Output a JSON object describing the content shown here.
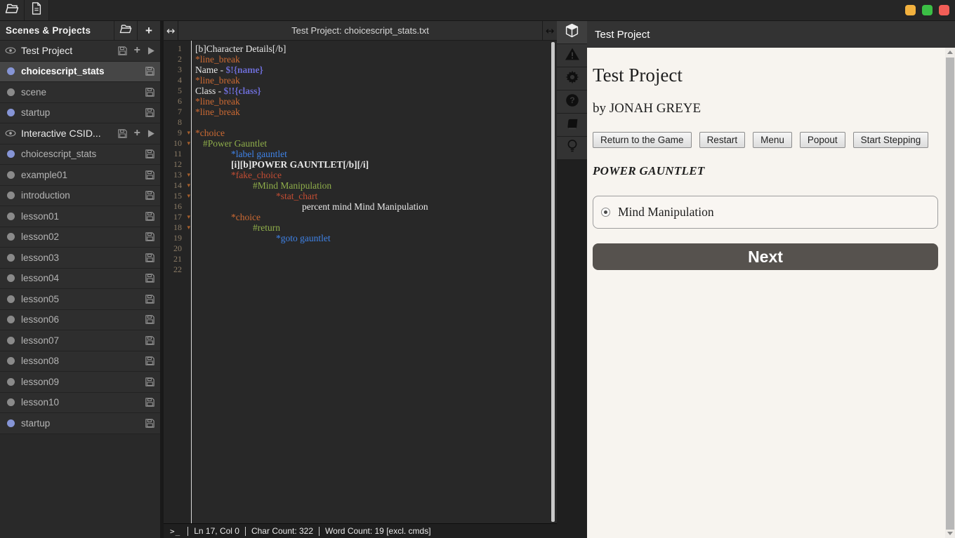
{
  "window": {
    "dots": [
      {
        "name": "minimize-dot",
        "color": "#f2b13e"
      },
      {
        "name": "maximize-dot",
        "color": "#3bbf45"
      },
      {
        "name": "close-dot",
        "color": "#f25e57"
      }
    ]
  },
  "sidebar": {
    "title": "Scenes & Projects",
    "items": [
      {
        "type": "project",
        "label": "Test Project"
      },
      {
        "type": "scene",
        "label": "choicescript_stats",
        "dot": "blue",
        "selected": true
      },
      {
        "type": "scene",
        "label": "scene",
        "dot": "gray"
      },
      {
        "type": "scene",
        "label": "startup",
        "dot": "blue"
      },
      {
        "type": "project",
        "label": "Interactive CSID..."
      },
      {
        "type": "scene",
        "label": "choicescript_stats",
        "dot": "blue"
      },
      {
        "type": "scene",
        "label": "example01",
        "dot": "gray"
      },
      {
        "type": "scene",
        "label": "introduction",
        "dot": "gray"
      },
      {
        "type": "scene",
        "label": "lesson01",
        "dot": "gray"
      },
      {
        "type": "scene",
        "label": "lesson02",
        "dot": "gray"
      },
      {
        "type": "scene",
        "label": "lesson03",
        "dot": "gray"
      },
      {
        "type": "scene",
        "label": "lesson04",
        "dot": "gray"
      },
      {
        "type": "scene",
        "label": "lesson05",
        "dot": "gray"
      },
      {
        "type": "scene",
        "label": "lesson06",
        "dot": "gray"
      },
      {
        "type": "scene",
        "label": "lesson07",
        "dot": "gray"
      },
      {
        "type": "scene",
        "label": "lesson08",
        "dot": "gray"
      },
      {
        "type": "scene",
        "label": "lesson09",
        "dot": "gray"
      },
      {
        "type": "scene",
        "label": "lesson10",
        "dot": "gray"
      },
      {
        "type": "scene",
        "label": "startup",
        "dot": "blue"
      }
    ]
  },
  "editor": {
    "title": "Test Project: choicescript_stats.txt",
    "lines": [
      {
        "n": 1,
        "indent": 0,
        "fold": false,
        "segs": [
          {
            "k": "txt",
            "t": "[b]Character Details[/b]"
          }
        ]
      },
      {
        "n": 2,
        "indent": 0,
        "fold": false,
        "segs": [
          {
            "k": "cmd",
            "t": "*line_break"
          }
        ]
      },
      {
        "n": 3,
        "indent": 0,
        "fold": false,
        "segs": [
          {
            "k": "txt",
            "t": "Name - "
          },
          {
            "k": "var",
            "t": "$!{name}"
          }
        ]
      },
      {
        "n": 4,
        "indent": 0,
        "fold": false,
        "segs": [
          {
            "k": "cmd",
            "t": "*line_break"
          }
        ]
      },
      {
        "n": 5,
        "indent": 0,
        "fold": false,
        "segs": [
          {
            "k": "txt",
            "t": "Class - "
          },
          {
            "k": "var",
            "t": "$!!{class}"
          }
        ]
      },
      {
        "n": 6,
        "indent": 0,
        "fold": false,
        "segs": [
          {
            "k": "cmd",
            "t": "*line_break"
          }
        ]
      },
      {
        "n": 7,
        "indent": 0,
        "fold": false,
        "segs": [
          {
            "k": "cmd",
            "t": "*line_break"
          }
        ]
      },
      {
        "n": 8,
        "indent": 0,
        "fold": false,
        "segs": []
      },
      {
        "n": 9,
        "indent": 0,
        "fold": true,
        "segs": [
          {
            "k": "cmd",
            "t": "*choice"
          }
        ]
      },
      {
        "n": 10,
        "indent": 11,
        "fold": true,
        "segs": [
          {
            "k": "opt",
            "t": "#Power Gauntlet"
          }
        ]
      },
      {
        "n": 11,
        "indent": 51,
        "fold": false,
        "segs": [
          {
            "k": "kw",
            "t": "*label gauntlet"
          }
        ]
      },
      {
        "n": 12,
        "indent": 51,
        "fold": false,
        "segs": [
          {
            "k": "txtb",
            "t": "[i][b]POWER GAUNTLET[/b][/i]"
          }
        ]
      },
      {
        "n": 13,
        "indent": 51,
        "fold": true,
        "segs": [
          {
            "k": "cmdr",
            "t": "*fake_choice"
          }
        ]
      },
      {
        "n": 14,
        "indent": 82,
        "fold": true,
        "segs": [
          {
            "k": "opt",
            "t": "#Mind Manipulation"
          }
        ]
      },
      {
        "n": 15,
        "indent": 115,
        "fold": true,
        "segs": [
          {
            "k": "cmdr",
            "t": "*stat_chart"
          }
        ]
      },
      {
        "n": 16,
        "indent": 152,
        "fold": false,
        "segs": [
          {
            "k": "txt",
            "t": "percent mind Mind Manipulation"
          }
        ]
      },
      {
        "n": 17,
        "indent": 51,
        "fold": true,
        "segs": [
          {
            "k": "cmd",
            "t": "*choice"
          }
        ]
      },
      {
        "n": 18,
        "indent": 82,
        "fold": true,
        "segs": [
          {
            "k": "opt",
            "t": "#return"
          }
        ]
      },
      {
        "n": 19,
        "indent": 115,
        "fold": false,
        "segs": [
          {
            "k": "kw",
            "t": "*goto gauntlet"
          }
        ]
      },
      {
        "n": 20,
        "indent": 0,
        "fold": false,
        "segs": []
      },
      {
        "n": 21,
        "indent": 0,
        "fold": false,
        "segs": []
      },
      {
        "n": 22,
        "indent": 0,
        "fold": false,
        "segs": []
      }
    ],
    "status": {
      "prompt": ">_",
      "segments": [
        "Ln 17, Col 0",
        "Char Count: 322",
        "Word Count: 19 [excl. cmds]"
      ]
    }
  },
  "tabstrip": {
    "tabs": [
      {
        "icon": "cube",
        "name": "game-tab",
        "active": true
      },
      {
        "icon": "warning",
        "name": "issues-tab",
        "active": false
      },
      {
        "icon": "gear",
        "name": "settings-tab",
        "active": false
      },
      {
        "icon": "help",
        "name": "help-tab",
        "active": false
      },
      {
        "icon": "book",
        "name": "documentation-tab",
        "active": false
      },
      {
        "icon": "bulb",
        "name": "tips-tab",
        "active": false
      }
    ]
  },
  "game": {
    "panel_title": "Test Project",
    "title": "Test Project",
    "author": "by JONAH GREYE",
    "buttons": [
      "Return to the Game",
      "Restart",
      "Menu",
      "Popout",
      "Start Stepping"
    ],
    "prompt": "POWER GAUNTLET",
    "choice_label": "Mind Manipulation",
    "next_label": "Next"
  },
  "colors": {
    "syntax": {
      "cmd": "#cd6a33",
      "cmdr": "#c44d33",
      "kw": "#3f83e8",
      "opt": "#8fae4a",
      "var": "#6b6bd1",
      "txt": "#e8e8e8",
      "num": "#8c7c66",
      "fold": "#a9602c"
    },
    "dot_blue": "#8695d6",
    "dot_gray": "#8a8a8a",
    "next_button_bg": "#56524e",
    "game_bg": "#f7f4ef"
  }
}
